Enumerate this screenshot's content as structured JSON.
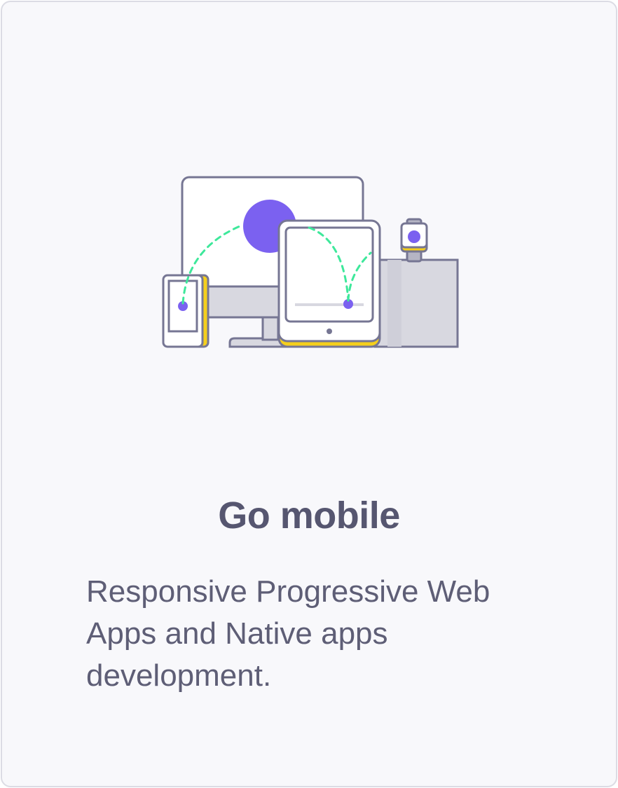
{
  "card": {
    "title": "Go mobile",
    "description": "Responsive Progressive Web Apps and Native apps development."
  },
  "illustration": {
    "icons": [
      "desktop-monitor-icon",
      "phone-icon",
      "tablet-icon",
      "smartwatch-icon"
    ],
    "colors": {
      "outline": "#767693",
      "accent_purple": "#7b61f0",
      "accent_green": "#3ee89b",
      "accent_yellow": "#f5cf1c",
      "panel_gray": "#d8d8e0"
    }
  }
}
